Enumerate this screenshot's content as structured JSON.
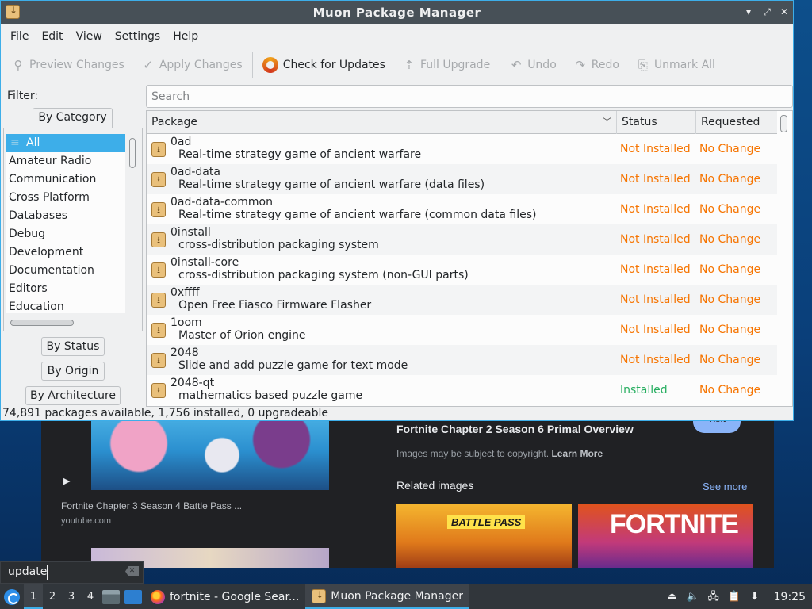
{
  "window": {
    "title": "Muon Package Manager",
    "menu": [
      "File",
      "Edit",
      "View",
      "Settings",
      "Help"
    ],
    "toolbar": [
      {
        "label": "Preview Changes",
        "icon": "magnifier-icon",
        "enabled": false
      },
      {
        "label": "Apply Changes",
        "icon": "checkmark-icon",
        "enabled": false
      },
      {
        "label": "Check for Updates",
        "icon": "refresh-icon",
        "enabled": true
      },
      {
        "label": "Full Upgrade",
        "icon": "upgrade-arrow-icon",
        "enabled": false
      },
      {
        "label": "Undo",
        "icon": "undo-icon",
        "enabled": false
      },
      {
        "label": "Redo",
        "icon": "redo-icon",
        "enabled": false
      },
      {
        "label": "Unmark All",
        "icon": "unmark-icon",
        "enabled": false
      }
    ],
    "filter_label": "Filter:",
    "filter_tabs": {
      "by_category": "By Category",
      "by_status": "By Status",
      "by_origin": "By Origin",
      "by_architecture": "By Architecture"
    },
    "categories": [
      "All",
      "Amateur Radio",
      "Communication",
      "Cross Platform",
      "Databases",
      "Debug",
      "Development",
      "Documentation",
      "Editors",
      "Education"
    ],
    "selected_category": "All",
    "search_placeholder": "Search",
    "columns": {
      "package": "Package",
      "status": "Status",
      "requested": "Requested"
    },
    "packages": [
      {
        "name": "0ad",
        "description": "Real-time strategy game of ancient warfare",
        "status": "Not Installed",
        "requested": "No Change"
      },
      {
        "name": "0ad-data",
        "description": "Real-time strategy game of ancient warfare (data files)",
        "status": "Not Installed",
        "requested": "No Change"
      },
      {
        "name": "0ad-data-common",
        "description": "Real-time strategy game of ancient warfare (common data files)",
        "status": "Not Installed",
        "requested": "No Change"
      },
      {
        "name": "0install",
        "description": "cross-distribution packaging system",
        "status": "Not Installed",
        "requested": "No Change"
      },
      {
        "name": "0install-core",
        "description": "cross-distribution packaging system (non-GUI parts)",
        "status": "Not Installed",
        "requested": "No Change"
      },
      {
        "name": "0xffff",
        "description": "Open Free Fiasco Firmware Flasher",
        "status": "Not Installed",
        "requested": "No Change"
      },
      {
        "name": "1oom",
        "description": "Master of Orion engine",
        "status": "Not Installed",
        "requested": "No Change"
      },
      {
        "name": "2048",
        "description": "Slide and add puzzle game for text mode",
        "status": "Not Installed",
        "requested": "No Change"
      },
      {
        "name": "2048-qt",
        "description": "mathematics based puzzle game",
        "status": "Installed",
        "requested": "No Change"
      }
    ],
    "statusbar": "74,891 packages available, 1,756 installed, 0 upgradeable",
    "colors": {
      "not_installed": "#f67400",
      "installed": "#27ae60",
      "selection": "#3daee9"
    }
  },
  "browser": {
    "video_title": "Fortnite Chapter 3 Season 4 Battle Pass ...",
    "video_source": "youtube.com",
    "result_title": "Fortnite Chapter 2 Season 6 Primal Overview",
    "copyright_text": "Images may be subject to copyright.",
    "learn_more": "Learn More",
    "visit": "Visit",
    "related_images": "Related images",
    "see_more": "See more",
    "img1_caption": "BATTLE PASS",
    "img2_caption": "FORTNITE"
  },
  "launcher_search": {
    "value": "update"
  },
  "taskbar": {
    "desktops": [
      "1",
      "2",
      "3",
      "4"
    ],
    "active_desktop": "1",
    "tasks": [
      {
        "label": "fortnite - Google Sear...",
        "icon": "firefox-icon"
      },
      {
        "label": "Muon Package Manager",
        "icon": "muon-icon"
      }
    ],
    "clock": "19:25"
  }
}
